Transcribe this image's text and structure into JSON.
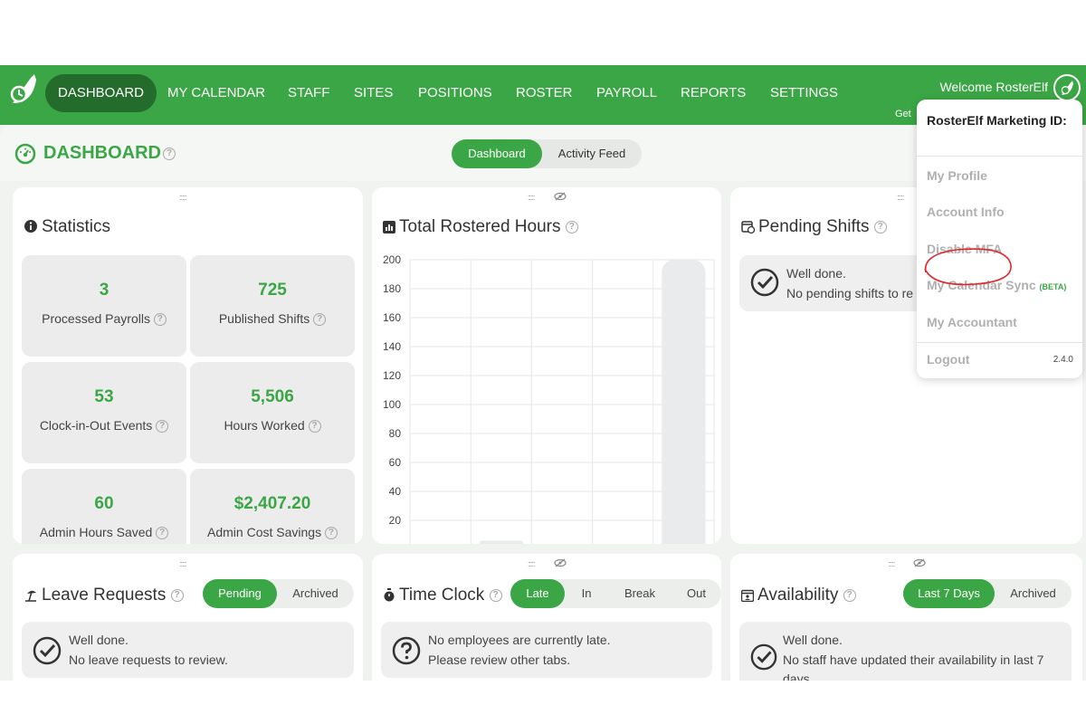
{
  "nav": {
    "items": [
      {
        "label": "DASHBOARD",
        "active": true
      },
      {
        "label": "MY CALENDAR"
      },
      {
        "label": "STAFF"
      },
      {
        "label": "SITES"
      },
      {
        "label": "POSITIONS"
      },
      {
        "label": "ROSTER"
      },
      {
        "label": "PAYROLL"
      },
      {
        "label": "REPORTS"
      },
      {
        "label": "SETTINGS"
      }
    ],
    "welcome": "Welcome RosterElf",
    "get_text": "Get"
  },
  "header": {
    "title": "DASHBOARD",
    "tabs": [
      "Dashboard",
      "Activity Feed"
    ],
    "active_tab": "Dashboard"
  },
  "statistics": {
    "title": "Statistics",
    "cards": [
      {
        "value": "3",
        "label": "Processed Payrolls"
      },
      {
        "value": "725",
        "label": "Published Shifts"
      },
      {
        "value": "53",
        "label": "Clock-in-Out Events"
      },
      {
        "value": "5,506",
        "label": "Hours Worked"
      },
      {
        "value": "60",
        "label": "Admin Hours Saved"
      },
      {
        "value": "$2,407.20",
        "label": "Admin Cost Savings"
      }
    ]
  },
  "rostered_hours": {
    "title": "Total Rostered Hours"
  },
  "chart_data": {
    "type": "bar",
    "title": "Total Rostered Hours",
    "ylim": [
      0,
      200
    ],
    "yticks": [
      20,
      40,
      60,
      80,
      100,
      120,
      140,
      160,
      180,
      200
    ],
    "categories": [
      "",
      "",
      "",
      "",
      ""
    ],
    "values": [
      3,
      6,
      0,
      0,
      200
    ],
    "grid": true
  },
  "pending_shifts": {
    "title": "Pending Shifts",
    "line1": "Well done.",
    "line2": "No pending shifts to re"
  },
  "leave": {
    "title": "Leave Requests",
    "tabs": [
      "Pending",
      "Archived"
    ],
    "line1": "Well done.",
    "line2": "No leave requests to review."
  },
  "timeclock": {
    "title": "Time Clock",
    "tabs": [
      "Late",
      "In",
      "Break",
      "Out"
    ],
    "line1": "No employees are currently late.",
    "line2": "Please review other tabs."
  },
  "availability": {
    "title": "Availability",
    "tabs": [
      "Last 7 Days",
      "Archived"
    ],
    "line1": "Well done.",
    "line2": "No staff have updated their availability in last 7",
    "line3": "days."
  },
  "dropdown": {
    "account_name": "RosterElf Marketing ID:",
    "items": [
      "My Profile",
      "Account Info",
      "Disable MFA",
      "My Calendar Sync",
      "My Accountant",
      "Logout"
    ],
    "beta": "(BETA)",
    "version": "2.4.0"
  },
  "colors": {
    "brand_green": "#3ba645",
    "nav_active": "#236c2b",
    "annotation_red": "#e0262b"
  }
}
